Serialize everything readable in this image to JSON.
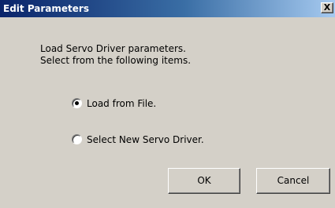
{
  "window": {
    "title": "Edit Parameters",
    "close_glyph": "X"
  },
  "message": {
    "line1": "Load Servo Driver parameters.",
    "line2": "Select from the following items."
  },
  "options": [
    {
      "label": "Load from File.",
      "selected": true
    },
    {
      "label": "Select New Servo Driver.",
      "selected": false
    }
  ],
  "buttons": {
    "ok": "OK",
    "cancel": "Cancel"
  },
  "colors": {
    "dialog_face": "#d4d0c8",
    "titlebar_start": "#0a246a",
    "titlebar_end": "#a6caf0"
  }
}
